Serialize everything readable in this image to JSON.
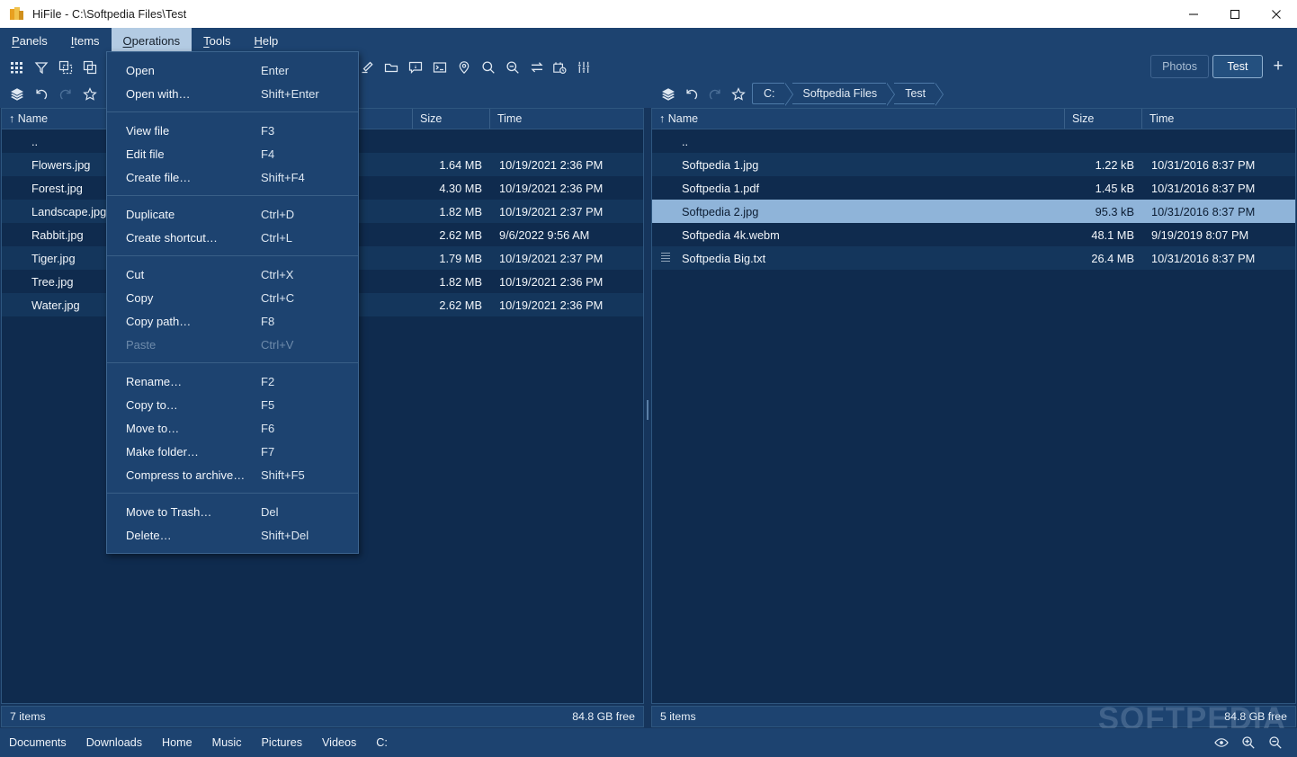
{
  "window": {
    "title": "HiFile - C:\\Softpedia Files\\Test",
    "app_icon": "hifile-logo-icon",
    "minimize_label": "—",
    "maximize_label": "☐",
    "close_label": "✕"
  },
  "menubar": {
    "items": [
      {
        "label": "Panels",
        "mnemonic": "P",
        "active": false
      },
      {
        "label": "Items",
        "mnemonic": "I",
        "active": false
      },
      {
        "label": "Operations",
        "mnemonic": "O",
        "active": true
      },
      {
        "label": "Tools",
        "mnemonic": "T",
        "active": false
      },
      {
        "label": "Help",
        "mnemonic": "H",
        "active": false
      }
    ]
  },
  "operations_menu": {
    "groups": [
      [
        {
          "label": "Open",
          "accel": "Enter",
          "disabled": false
        },
        {
          "label": "Open with…",
          "accel": "Shift+Enter",
          "disabled": false
        }
      ],
      [
        {
          "label": "View file",
          "accel": "F3",
          "disabled": false
        },
        {
          "label": "Edit file",
          "accel": "F4",
          "disabled": false
        },
        {
          "label": "Create file…",
          "accel": "Shift+F4",
          "disabled": false
        }
      ],
      [
        {
          "label": "Duplicate",
          "accel": "Ctrl+D",
          "disabled": false
        },
        {
          "label": "Create shortcut…",
          "accel": "Ctrl+L",
          "disabled": false
        }
      ],
      [
        {
          "label": "Cut",
          "accel": "Ctrl+X",
          "disabled": false
        },
        {
          "label": "Copy",
          "accel": "Ctrl+C",
          "disabled": false
        },
        {
          "label": "Copy path…",
          "accel": "F8",
          "disabled": false
        },
        {
          "label": "Paste",
          "accel": "Ctrl+V",
          "disabled": true
        }
      ],
      [
        {
          "label": "Rename…",
          "accel": "F2",
          "disabled": false
        },
        {
          "label": "Copy to…",
          "accel": "F5",
          "disabled": false
        },
        {
          "label": "Move to…",
          "accel": "F6",
          "disabled": false
        },
        {
          "label": "Make folder…",
          "accel": "F7",
          "disabled": false
        },
        {
          "label": "Compress to archive…",
          "accel": "Shift+F5",
          "disabled": false
        }
      ],
      [
        {
          "label": "Move to Trash…",
          "accel": "Del",
          "disabled": false
        },
        {
          "label": "Delete…",
          "accel": "Shift+Del",
          "disabled": false
        }
      ]
    ]
  },
  "toolbar_left_row1": [
    {
      "icon": "grid-view-icon"
    },
    {
      "icon": "filter-icon"
    },
    {
      "icon": "select-region-icon"
    },
    {
      "icon": "copy-panel-icon"
    },
    {
      "icon": "duplicate-panel-icon"
    }
  ],
  "toolbar_left_row2": [
    {
      "icon": "layers-icon"
    },
    {
      "icon": "undo-icon"
    },
    {
      "icon": "redo-icon",
      "disabled": true
    },
    {
      "icon": "star-icon"
    }
  ],
  "toolbar_center_row1": [
    {
      "icon": "eraser-icon"
    },
    {
      "icon": "folder-open-icon"
    },
    {
      "icon": "info-bubble-icon"
    },
    {
      "icon": "terminal-icon"
    },
    {
      "icon": "location-pin-icon"
    },
    {
      "icon": "zoom-in-search-icon"
    },
    {
      "icon": "zoom-out-search-icon"
    },
    {
      "icon": "sync-swap-icon"
    },
    {
      "icon": "history-calendar-icon"
    },
    {
      "icon": "settings-sliders-icon"
    }
  ],
  "toolbar_right_row2": [
    {
      "icon": "layers-icon"
    },
    {
      "icon": "undo-icon"
    },
    {
      "icon": "redo-icon",
      "disabled": true
    },
    {
      "icon": "star-icon"
    }
  ],
  "tabs": {
    "items": [
      {
        "label": "Photos",
        "selected": false
      },
      {
        "label": "Test",
        "selected": true
      }
    ],
    "add_label": "+"
  },
  "left_panel": {
    "tab_label": "Photos",
    "columns": [
      "↑ Name",
      "Size",
      "Time"
    ],
    "rows": [
      {
        "name": "..",
        "icon": "folder-icon",
        "size": "",
        "time": "",
        "selected": false
      },
      {
        "name": "Flowers.jpg",
        "icon": "image-icon",
        "size": "1.64 MB",
        "time": "10/19/2021 2:36 PM",
        "selected": false
      },
      {
        "name": "Forest.jpg",
        "icon": "image-icon",
        "size": "4.30 MB",
        "time": "10/19/2021 2:36 PM",
        "selected": false
      },
      {
        "name": "Landscape.jpg",
        "icon": "image-icon",
        "size": "1.82 MB",
        "time": "10/19/2021 2:37 PM",
        "selected": false
      },
      {
        "name": "Rabbit.jpg",
        "icon": "image-icon",
        "size": "2.62 MB",
        "time": "9/6/2022 9:56 AM",
        "selected": false
      },
      {
        "name": "Tiger.jpg",
        "icon": "image-icon",
        "size": "1.79 MB",
        "time": "10/19/2021 2:37 PM",
        "selected": false
      },
      {
        "name": "Tree.jpg",
        "icon": "image-icon",
        "size": "1.82 MB",
        "time": "10/19/2021 2:36 PM",
        "selected": false
      },
      {
        "name": "Water.jpg",
        "icon": "image-icon",
        "size": "2.62 MB",
        "time": "10/19/2021 2:36 PM",
        "selected": false
      }
    ],
    "status_items": "7 items",
    "status_free": "84.8 GB free"
  },
  "right_panel": {
    "breadcrumbs": [
      "C:",
      "Softpedia Files",
      "Test"
    ],
    "columns": [
      "↑ Name",
      "Size",
      "Time"
    ],
    "rows": [
      {
        "name": "..",
        "icon": "folder-icon",
        "size": "",
        "time": "",
        "selected": false
      },
      {
        "name": "Softpedia 1.jpg",
        "icon": "image-icon",
        "size": "1.22 kB",
        "time": "10/31/2016 8:37 PM",
        "selected": false
      },
      {
        "name": "Softpedia 1.pdf",
        "icon": "pdf-icon",
        "size": "1.45 kB",
        "time": "10/31/2016 8:37 PM",
        "selected": false
      },
      {
        "name": "Softpedia 2.jpg",
        "icon": "image-icon",
        "size": "95.3 kB",
        "time": "10/31/2016 8:37 PM",
        "selected": true
      },
      {
        "name": "Softpedia 4k.webm",
        "icon": "video-icon",
        "size": "48.1 MB",
        "time": "9/19/2019 8:07 PM",
        "selected": false
      },
      {
        "name": "Softpedia Big.txt",
        "icon": "text-icon",
        "size": "26.4 MB",
        "time": "10/31/2016 8:37 PM",
        "selected": false
      }
    ],
    "status_items": "5 items",
    "status_free": "84.8 GB free"
  },
  "footer": {
    "shortcuts": [
      "Documents",
      "Downloads",
      "Home",
      "Music",
      "Pictures",
      "Videos",
      "C:"
    ],
    "icons": [
      {
        "icon": "eye-preview-icon"
      },
      {
        "icon": "zoom-in-icon"
      },
      {
        "icon": "zoom-out-icon"
      }
    ]
  },
  "watermark": "SOFTPEDIA",
  "colors": {
    "chrome": "#1d4370",
    "panel_bg": "#0f2b4e",
    "row_alt": "#14365c",
    "selection": "#8fb4d9",
    "titlebar": "#ffffff",
    "accent_folder": "#f0bd5a",
    "menu_active": "#b3cbe3"
  }
}
